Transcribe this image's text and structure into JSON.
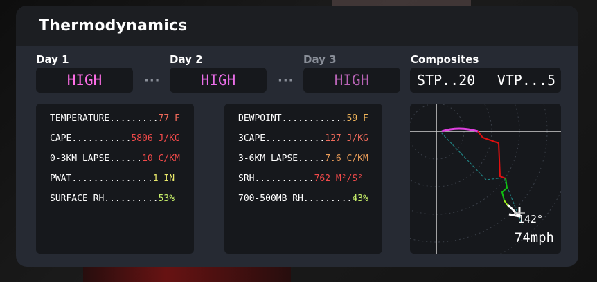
{
  "panel": {
    "title": "Thermodynamics"
  },
  "days": [
    {
      "label": "Day 1",
      "risk": "HIGH",
      "risk_color": "#ff6ee8",
      "label_color": "#ffffff"
    },
    {
      "label": "Day 2",
      "risk": "HIGH",
      "risk_color": "#ea6ee8",
      "label_color": "#ffffff"
    },
    {
      "label": "Day 3",
      "risk": "HIGH",
      "risk_color": "#b964b6",
      "label_color": "#8a8f99"
    }
  ],
  "separators": [
    "···",
    "···"
  ],
  "composites": {
    "label": "Composites",
    "stp": "STP..20",
    "vtp": "VTP...5"
  },
  "left_params": [
    {
      "label": "TEMPERATURE",
      "dots": ".........",
      "value": "77 F",
      "color": "#f06a5a"
    },
    {
      "label": "CAPE",
      "dots": "...........",
      "value": "5806 J/KG",
      "color": "#f24a4a"
    },
    {
      "label": "0-3KM LAPSE",
      "dots": "......",
      "value": "10 C/KM",
      "color": "#f24a4a"
    },
    {
      "label": "PWAT",
      "dots": "...............",
      "value": "1 IN",
      "color": "#e8e86a"
    },
    {
      "label": "SURFACE RH",
      "dots": "..........",
      "value": "53%",
      "color": "#c8f06a"
    }
  ],
  "right_params": [
    {
      "label": "DEWPOINT",
      "dots": "............",
      "value": "59 F",
      "color": "#f0b45a"
    },
    {
      "label": "3CAPE",
      "dots": "...........",
      "value": "127 J/KG",
      "color": "#f06a5a"
    },
    {
      "label": "3-6KM LAPSE",
      "dots": ".....",
      "value": "7.6 C/KM",
      "color": "#f0a05a"
    },
    {
      "label": "SRH",
      "dots": "...........",
      "value": "762 M²/S²",
      "color": "#f24a4a"
    },
    {
      "label": "700-500MB RH",
      "dots": ".........",
      "value": "43%",
      "color": "#c8f06a"
    }
  ],
  "hodograph": {
    "storm_direction": "142°",
    "storm_speed": "74mph",
    "colors": {
      "low": "#e040e0",
      "mid": "#e01010",
      "upper": "#10c010",
      "upper2": "#a0f020",
      "storm": "#208080",
      "axis": "#d0d0d0"
    }
  }
}
